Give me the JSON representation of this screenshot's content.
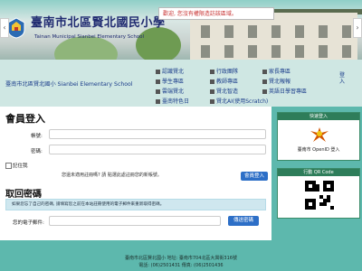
{
  "header": {
    "welcome": "歡迎, 您沒有權限造訪該區域。",
    "school_name": "臺南市北區賢北國民小學",
    "school_name_en": "Tainan Municipal Sianbei Elementary School",
    "prev_arrow": "‹",
    "next_arrow": "›"
  },
  "nav": {
    "site_title": "臺南市北區賢北國小 Sianbei Elementary School",
    "items": [
      {
        "label": "認識賢北"
      },
      {
        "label": "行政團隊"
      },
      {
        "label": "家長專區"
      },
      {
        "label": "學生專區"
      },
      {
        "label": "教師專區"
      },
      {
        "label": "賢北報報"
      },
      {
        "label": "雲端賢北"
      },
      {
        "label": "賢北智造"
      },
      {
        "label": "英語日學習專區"
      },
      {
        "label": "臺南特色日"
      },
      {
        "label": "賢北AI(使用Scratch)"
      }
    ],
    "login_menu": "登入"
  },
  "login": {
    "title": "會員登入",
    "account_label": "帳號:",
    "password_label": "密碼:",
    "remember_label": "記住我",
    "hint": "您還未適用註冊嗎? 請 點選此處註冊您的新帳號。",
    "submit": "會員登入"
  },
  "recover": {
    "title": "取回密碼",
    "alert": "如果您忘了自己的密碼, 請填寫您之前在本站註冊使用的電子郵件來重新取得密碼。",
    "email_label": "您的電子郵件:",
    "submit": "傳送密碼"
  },
  "sidebar": {
    "quick_login_title": "快速登入",
    "openid_label": "臺南市 OpenID 登入",
    "qr_title": "行動 QR Code"
  },
  "footer": {
    "line1": "臺南市北區賢北國小 地址: 臺南市704北區大興街316號",
    "line2": "電話: (06)2501431 傳真: (06)2501436"
  }
}
